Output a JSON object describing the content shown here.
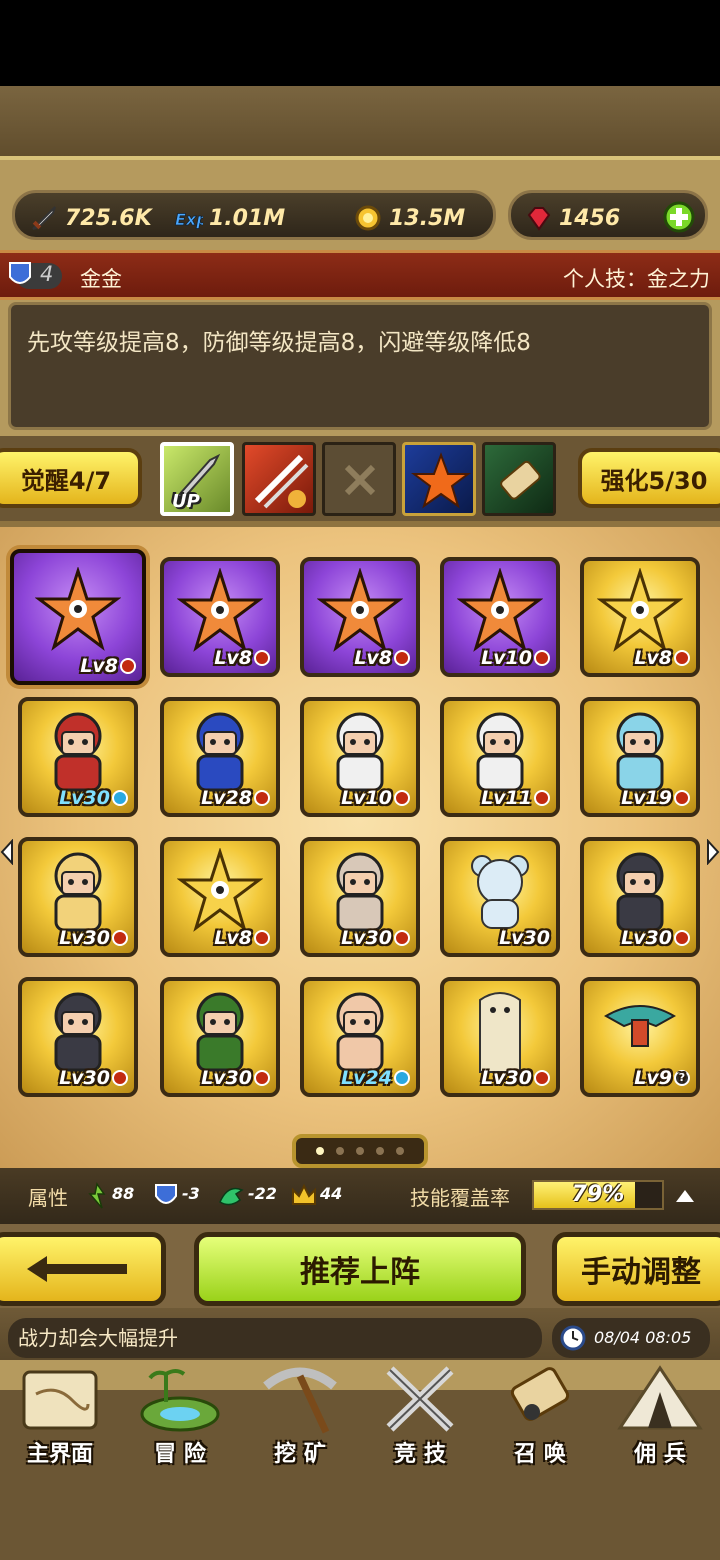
{
  "resources": {
    "attack": "725.6K",
    "exp": "1.01M",
    "gold": "13.5M",
    "gems": "1456"
  },
  "hero": {
    "rank": "4",
    "name": "金金",
    "personal_skill": "个人技：金之力",
    "description": "先攻等级提高8，防御等级提高8，闪避等级降低8"
  },
  "skill_row": {
    "awaken": "觉醒4/7",
    "enhance": "强化5/30",
    "up_badge": "UP"
  },
  "cards": [
    {
      "lv": "Lv8",
      "frame": "purple",
      "badge": "red",
      "fig": "star"
    },
    {
      "lv": "Lv8",
      "frame": "purple",
      "badge": "red",
      "fig": "star"
    },
    {
      "lv": "Lv8",
      "frame": "purple",
      "badge": "red",
      "fig": "star"
    },
    {
      "lv": "Lv10",
      "frame": "purple",
      "badge": "red",
      "fig": "star"
    },
    {
      "lv": "Lv8",
      "frame": "gold",
      "badge": "red",
      "fig": "goldstar"
    },
    {
      "lv": "Lv30",
      "frame": "gold",
      "badge": "blue",
      "fig": "hero-red"
    },
    {
      "lv": "Lv28",
      "frame": "gold",
      "badge": "red",
      "fig": "hero-blue"
    },
    {
      "lv": "Lv10",
      "frame": "gold",
      "badge": "red",
      "fig": "hero-white"
    },
    {
      "lv": "Lv11",
      "frame": "gold",
      "badge": "red",
      "fig": "hero-white"
    },
    {
      "lv": "Lv19",
      "frame": "gold",
      "badge": "red",
      "fig": "hero-cyan"
    },
    {
      "lv": "Lv30",
      "frame": "gold",
      "badge": "red",
      "fig": "hero-blonde"
    },
    {
      "lv": "Lv8",
      "frame": "gold",
      "badge": "red",
      "fig": "goldstar"
    },
    {
      "lv": "Lv30",
      "frame": "gold",
      "badge": "red",
      "fig": "hero-beard"
    },
    {
      "lv": "Lv30",
      "frame": "gold",
      "badge": "none",
      "fig": "bear"
    },
    {
      "lv": "Lv30",
      "frame": "gold",
      "badge": "red",
      "fig": "hero-dark"
    },
    {
      "lv": "Lv30",
      "frame": "gold",
      "badge": "red",
      "fig": "hero-dark"
    },
    {
      "lv": "Lv30",
      "frame": "gold",
      "badge": "red",
      "fig": "hero-green"
    },
    {
      "lv": "Lv24",
      "frame": "gold",
      "badge": "blue",
      "fig": "hero-bald"
    },
    {
      "lv": "Lv30",
      "frame": "gold",
      "badge": "red",
      "fig": "ghost"
    },
    {
      "lv": "Lv9",
      "frame": "gold",
      "badge": "question",
      "fig": "bird"
    }
  ],
  "attributes": {
    "label": "属性",
    "agility": "88",
    "defense": "-3",
    "dodge": "-22",
    "crown": "44",
    "coverage_label": "技能覆盖率",
    "coverage_value": "79%",
    "coverage_fraction": 0.79
  },
  "buttons": {
    "recommend": "推荐上阵",
    "manual": "手动调整"
  },
  "tip": "战力却会大幅提升",
  "clock": "08/04 08:05",
  "nav": {
    "home": "主界面",
    "adventure": "冒 险",
    "mine": "挖 矿",
    "arena": "竞 技",
    "summon": "召 唤",
    "mercenary": "佣 兵"
  },
  "colors": {
    "gold_frame": "#f3c93a",
    "purple_frame": "#8d45d8",
    "name_bar": "#8d2c17",
    "button_green": "#c6f24a"
  }
}
